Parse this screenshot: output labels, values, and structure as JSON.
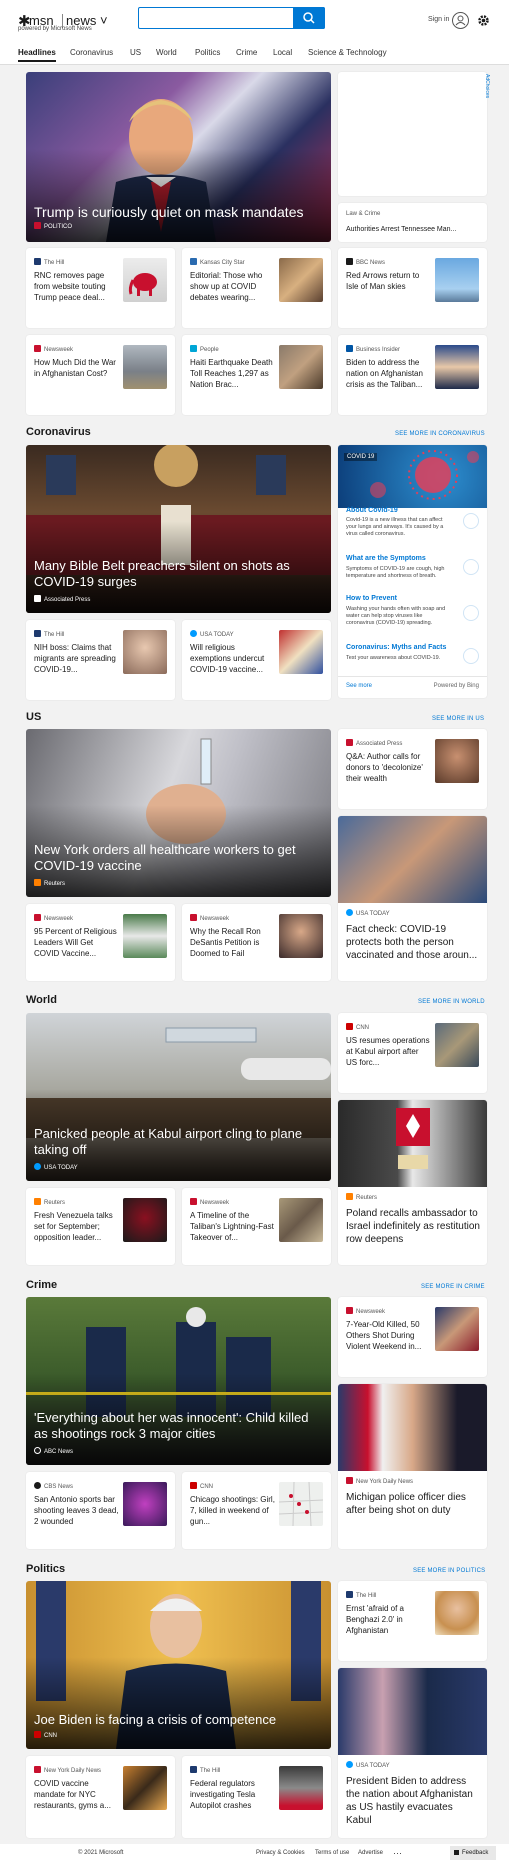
{
  "header": {
    "logo_mark": "✱",
    "logo_brand": "msn",
    "logo_section": "news",
    "logo_caret": "˅",
    "powered_by": "powered by Microsoft News",
    "search_value": "",
    "search_placeholder": "",
    "search_icon": "search-icon",
    "signin": "Sign in",
    "accent": "#0078d4"
  },
  "nav": {
    "items": [
      "Headlines",
      "Coronavirus",
      "US",
      "World",
      "Politics",
      "Crime",
      "Local",
      "Science & Technology"
    ]
  },
  "headlines": {
    "hero": {
      "title": "Trump is curiously quiet on mask mandates",
      "source": "POLITICO",
      "carousel_slides": 12,
      "active_slide": 1
    },
    "ad_label": "AdChoices",
    "side1": {
      "source": "Law & Crime",
      "title": "Authorities Arrest Tennessee Man..."
    },
    "row1": [
      {
        "source": "The Hill",
        "title": "RNC removes page from website touting Trump peace deal..."
      },
      {
        "source": "Kansas City Star",
        "title": "Editorial: Those who show up at COVID debates wearing..."
      },
      {
        "source": "BBC News",
        "title": "Red Arrows return to Isle of Man skies"
      }
    ],
    "row2": [
      {
        "source": "Newsweek",
        "title": "How Much Did the War in Afghanistan Cost?"
      },
      {
        "source": "People",
        "title": "Haiti Earthquake Death Toll Reaches 1,297 as Nation Brac..."
      },
      {
        "source": "Business Insider",
        "title": "Biden to address the nation on Afghanistan crisis as the Taliban..."
      }
    ]
  },
  "coronavirus": {
    "section_title": "Coronavirus",
    "more": "SEE MORE IN CORONAVIRUS",
    "hero": {
      "title": "Many Bible Belt preachers silent on shots as COVID-19 surges",
      "source": "Associated Press"
    },
    "panel": {
      "tag": "COVID 19",
      "topics": [
        {
          "title": "About Covid-19",
          "desc": "Covid-19 is a new illness that can affect your lungs and airways. It's caused by a virus called coronavirus."
        },
        {
          "title": "What are the Symptoms",
          "desc": "Symptoms of COVID-19 are cough, high temperature and shortness of breath."
        },
        {
          "title": "How to Prevent",
          "desc": "Washing your hands often with soap and water can help stop viruses like coronavirus (COVID-19) spreading."
        },
        {
          "title": "Coronavirus: Myths and Facts",
          "desc": "Test your awareness about COVID-19."
        }
      ],
      "see_more": "See more",
      "powered": "Powered by Bing"
    },
    "row": [
      {
        "source": "The Hill",
        "title": "NIH boss: Claims that migrants are spreading COVID-19..."
      },
      {
        "source": "USA TODAY",
        "title": "Will religious exemptions undercut COVID-19 vaccine..."
      }
    ]
  },
  "us": {
    "section_title": "US",
    "more": "SEE MORE IN US",
    "hero": {
      "title": "New York orders all healthcare workers to get COVID-19 vaccine",
      "source": "Reuters"
    },
    "side1": {
      "source": "Associated Press",
      "title": "Q&A: Author calls for donors to 'decolonize' their wealth"
    },
    "side2": {
      "source": "USA TODAY",
      "title": "Fact check: COVID-19 protects both the person vaccinated and those aroun..."
    },
    "row": [
      {
        "source": "Newsweek",
        "title": "95 Percent of Religious Leaders Will Get COVID Vaccine..."
      },
      {
        "source": "Newsweek",
        "title": "Why the Recall Ron DeSantis Petition is Doomed to Fail"
      }
    ]
  },
  "world": {
    "section_title": "World",
    "more": "SEE MORE IN WORLD",
    "hero": {
      "title": "Panicked people at Kabul airport cling to plane taking off",
      "source": "USA TODAY"
    },
    "side1": {
      "source": "CNN",
      "title": "US resumes operations at Kabul airport after US forc..."
    },
    "side2": {
      "source": "Reuters",
      "title": "Poland recalls ambassador to Israel indefinitely as restitution row deepens"
    },
    "row": [
      {
        "source": "Reuters",
        "title": "Fresh Venezuela talks set for September; opposition leader..."
      },
      {
        "source": "Newsweek",
        "title": "A Timeline of the Taliban's Lightning-Fast Takeover of..."
      }
    ]
  },
  "crime": {
    "section_title": "Crime",
    "more": "SEE MORE IN CRIME",
    "hero": {
      "title": "'Everything about her was innocent': Child killed as shootings rock 3 major cities",
      "source": "ABC News"
    },
    "side1": {
      "source": "Newsweek",
      "title": "7-Year-Old Killed, 50 Others Shot During Violent Weekend in..."
    },
    "side2": {
      "source": "New York Daily News",
      "title": "Michigan police officer dies after being shot on duty"
    },
    "row": [
      {
        "source": "CBS News",
        "title": "San Antonio sports bar shooting leaves 3 dead, 2 wounded"
      },
      {
        "source": "CNN",
        "title": "Chicago shootings: Girl, 7, killed in weekend of gun..."
      }
    ]
  },
  "politics": {
    "section_title": "Politics",
    "more": "SEE MORE IN POLITICS",
    "hero": {
      "title": "Joe Biden is facing a crisis of competence",
      "source": "CNN"
    },
    "side1": {
      "source": "The Hill",
      "title": "Ernst 'afraid of a Benghazi 2.0' in Afghanistan"
    },
    "side2": {
      "source": "USA TODAY",
      "title": "President Biden to address the nation about Afghanistan as US hastily evacuates Kabul"
    },
    "row": [
      {
        "source": "New York Daily News",
        "title": "COVID vaccine mandate for NYC restaurants, gyms a..."
      },
      {
        "source": "The Hill",
        "title": "Federal regulators investigating Tesla Autopilot crashes"
      }
    ]
  },
  "footer": {
    "copyright": "© 2021 Microsoft",
    "links": [
      "Privacy & Cookies",
      "Terms of use",
      "Advertise"
    ],
    "more": "···",
    "feedback": "Feedback"
  }
}
